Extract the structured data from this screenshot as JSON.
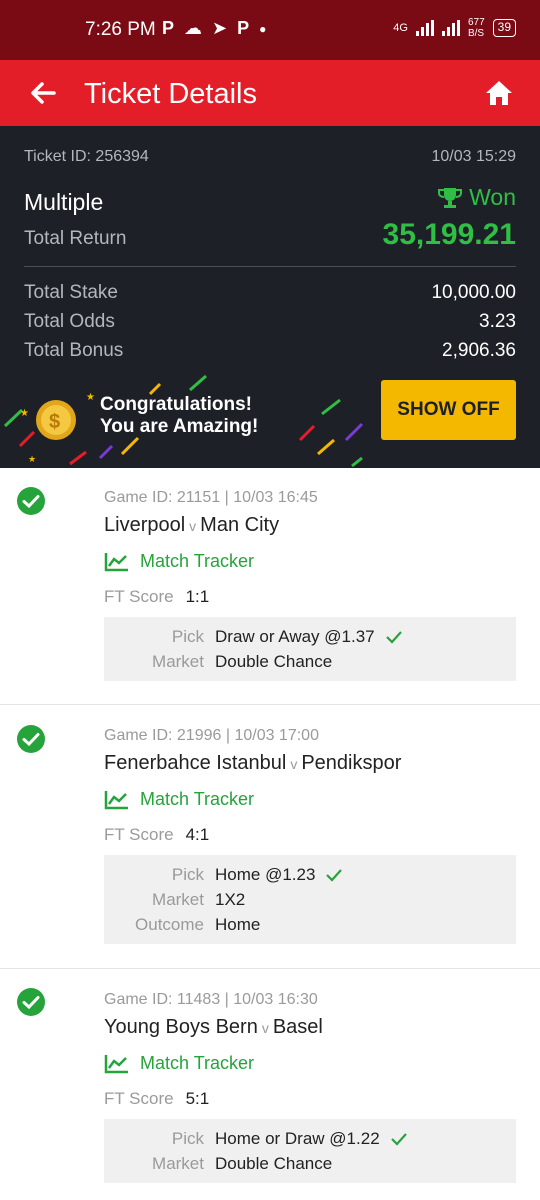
{
  "status_bar": {
    "time": "7:26 PM",
    "net": "4G",
    "speed_top": "677",
    "speed_bottom": "B/S",
    "battery": "39"
  },
  "header": {
    "title": "Ticket Details"
  },
  "summary": {
    "ticket_id": "Ticket ID: 256394",
    "datetime": "10/03 15:29",
    "bet_type": "Multiple",
    "status": "Won",
    "total_return_label": "Total Return",
    "total_return": "35,199.21",
    "stake_label": "Total Stake",
    "stake": "10,000.00",
    "odds_label": "Total Odds",
    "odds": "3.23",
    "bonus_label": "Total Bonus",
    "bonus": "2,906.36",
    "congrats_line1": "Congratulations!",
    "congrats_line2": "You are Amazing!",
    "show_off_label": "SHOW OFF"
  },
  "bets": [
    {
      "game": "Game ID: 21151 | 10/03 16:45",
      "home": "Liverpool",
      "away": "Man City",
      "tracker": "Match Tracker",
      "ft_label": "FT Score",
      "ft": "1:1",
      "rows": [
        {
          "label": "Pick",
          "value": "Draw or Away @1.37",
          "check": true
        },
        {
          "label": "Market",
          "value": "Double Chance"
        }
      ]
    },
    {
      "game": "Game ID: 21996 | 10/03 17:00",
      "home": "Fenerbahce Istanbul",
      "away": "Pendikspor",
      "tracker": "Match Tracker",
      "ft_label": "FT Score",
      "ft": "4:1",
      "rows": [
        {
          "label": "Pick",
          "value": "Home @1.23",
          "check": true
        },
        {
          "label": "Market",
          "value": "1X2"
        },
        {
          "label": "Outcome",
          "value": "Home"
        }
      ]
    },
    {
      "game": "Game ID: 11483 | 10/03 16:30",
      "home": "Young Boys Bern",
      "away": "Basel",
      "tracker": "Match Tracker",
      "ft_label": "FT Score",
      "ft": "5:1",
      "rows": [
        {
          "label": "Pick",
          "value": "Home or Draw @1.22",
          "check": true
        },
        {
          "label": "Market",
          "value": "Double Chance"
        }
      ]
    }
  ],
  "colors": {
    "primary": "#e41e29",
    "status_bar": "#7a0a14",
    "dark": "#1e2027",
    "win_green": "#2fbf45",
    "button": "#f5b800"
  }
}
